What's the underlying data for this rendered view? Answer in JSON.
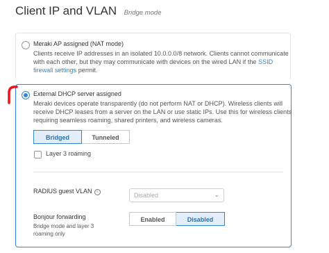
{
  "header": {
    "title": "Client IP and VLAN",
    "subtitle": "Bridge mode"
  },
  "option_nat": {
    "title": "Meraki AP assigned (NAT mode)",
    "desc_line1": "Clients receive IP addresses in an isolated 10.0.0.0/8 network. Clients cannot communicate",
    "desc_line2_pre": "with each other, but they may communicate with devices on the wired LAN if the ",
    "desc_link_a": "SSID",
    "desc_link_b": "firewall settings",
    "desc_line3_post": " permit.",
    "selected": false
  },
  "option_dhcp": {
    "title": "External DHCP server assigned",
    "desc_line1": "Meraki devices operate transparently (do not perform NAT or DHCP). Wireless clients will",
    "desc_line2": "receive DHCP leases from a server on the LAN or use static IPs. Use this for wireless clients",
    "desc_line3": "requiring seamless roaming, shared printers, and wireless cameras.",
    "selected": true,
    "mode_toggle": {
      "options": [
        "Bridged",
        "Tunneled"
      ],
      "selected": "Bridged"
    },
    "layer3_roaming": {
      "label": "Layer 3 roaming",
      "checked": false
    },
    "radius_guest_vlan": {
      "label": "RADIUS guest VLAN",
      "value": "Disabled"
    },
    "bonjour": {
      "label": "Bonjour forwarding",
      "sub_line1": "Bridge mode and layer 3",
      "sub_line2": "roaming only",
      "options": [
        "Enabled",
        "Disabled"
      ],
      "selected": "Disabled"
    }
  },
  "colors": {
    "accent": "#2f87d8",
    "annotation": "#e8151b",
    "active_bg": "#e4eefa"
  },
  "icons": {
    "info": "info-icon",
    "chevron": "chevron-down-icon"
  }
}
